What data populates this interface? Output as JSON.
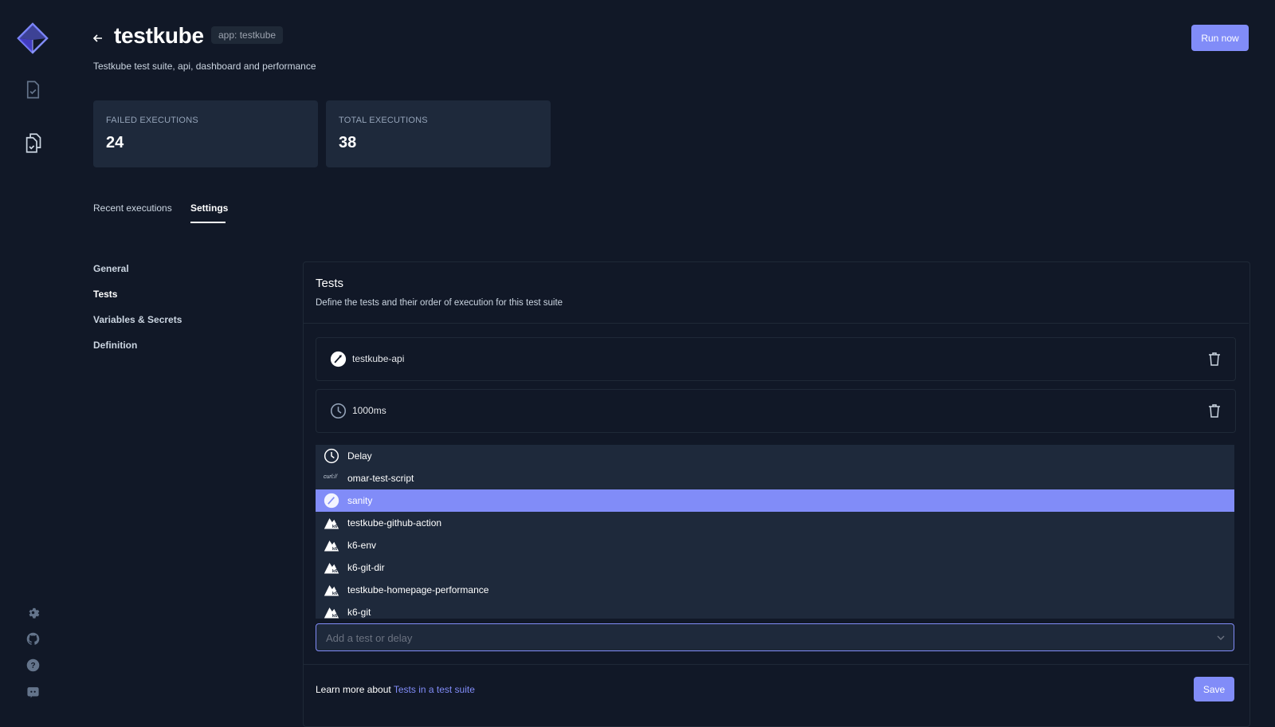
{
  "sidebar": {
    "logo": "testkube-logo-icon",
    "nav": [
      {
        "name": "tests-icon"
      },
      {
        "name": "test-suites-icon"
      }
    ],
    "bottom": [
      {
        "name": "settings-icon"
      },
      {
        "name": "github-icon"
      },
      {
        "name": "help-icon"
      },
      {
        "name": "discord-icon"
      }
    ]
  },
  "header": {
    "title": "testkube",
    "badge": "app: testkube",
    "subtitle": "Testkube test suite, api, dashboard and performance",
    "run_label": "Run now"
  },
  "stats": [
    {
      "label": "FAILED EXECUTIONS",
      "value": "24"
    },
    {
      "label": "TOTAL EXECUTIONS",
      "value": "38"
    }
  ],
  "tabs": [
    {
      "label": "Recent executions",
      "active": false
    },
    {
      "label": "Settings",
      "active": true
    }
  ],
  "settings_nav": [
    {
      "label": "General"
    },
    {
      "label": "Tests"
    },
    {
      "label": "Variables & Secrets"
    },
    {
      "label": "Definition"
    }
  ],
  "panel": {
    "title": "Tests",
    "description": "Define the tests and their order of execution for this test suite",
    "steps": [
      {
        "label": "testkube-api",
        "icon": "postman-icon"
      },
      {
        "label": "1000ms",
        "icon": "clock-icon"
      }
    ],
    "dropdown": [
      {
        "label": "Delay",
        "icon": "clock-icon"
      },
      {
        "label": "omar-test-script",
        "icon": "curl-icon",
        "icon_text": "curl://"
      },
      {
        "label": "sanity",
        "icon": "postman-icon",
        "selected": true
      },
      {
        "label": "testkube-github-action",
        "icon": "k6-icon"
      },
      {
        "label": "k6-env",
        "icon": "k6-icon"
      },
      {
        "label": "k6-git-dir",
        "icon": "k6-icon"
      },
      {
        "label": "testkube-homepage-performance",
        "icon": "k6-icon"
      },
      {
        "label": "k6-git",
        "icon": "k6-icon"
      }
    ],
    "select_placeholder": "Add a test or delay",
    "footer_text": "Learn more about ",
    "footer_link": "Tests in a test suite",
    "save_label": "Save"
  },
  "colors": {
    "background": "#111827",
    "card": "#1e293b",
    "accent": "#818cf8"
  }
}
